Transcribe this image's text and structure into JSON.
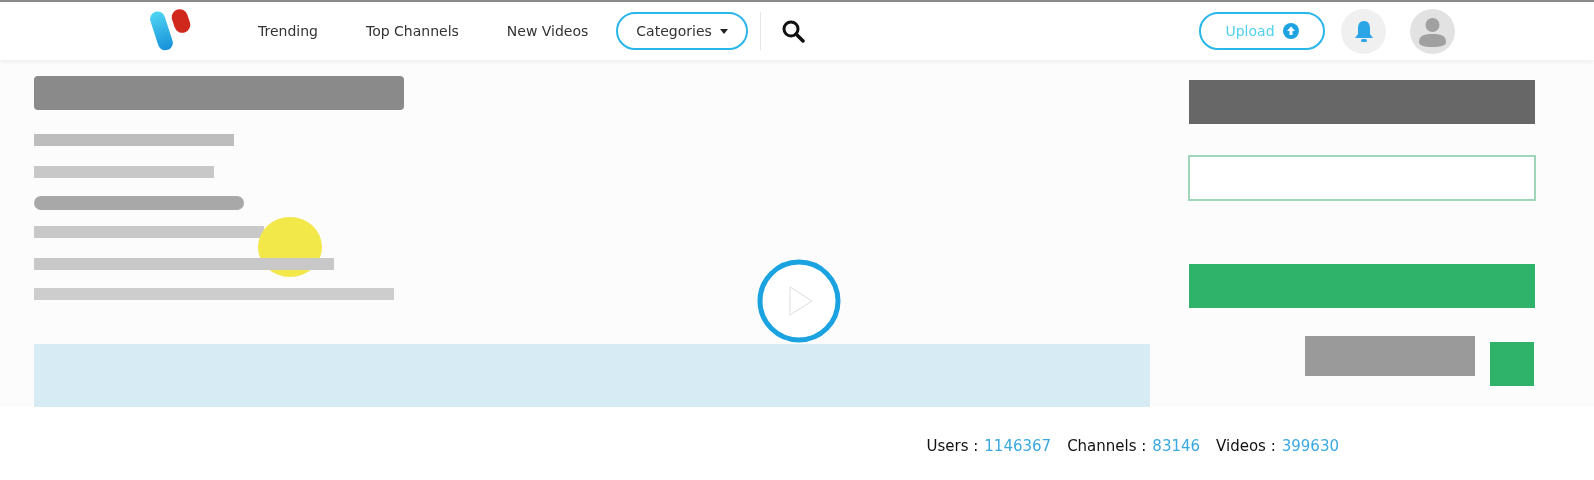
{
  "header": {
    "nav": [
      {
        "label": "Trending"
      },
      {
        "label": "Top Channels"
      },
      {
        "label": "New Videos"
      }
    ],
    "categories": {
      "label": "Categories"
    },
    "upload": {
      "label": "Upload"
    }
  },
  "stats": [
    {
      "label": "Users :",
      "value": "1146367"
    },
    {
      "label": "Channels :",
      "value": "83146"
    },
    {
      "label": "Videos :",
      "value": "399630"
    }
  ]
}
